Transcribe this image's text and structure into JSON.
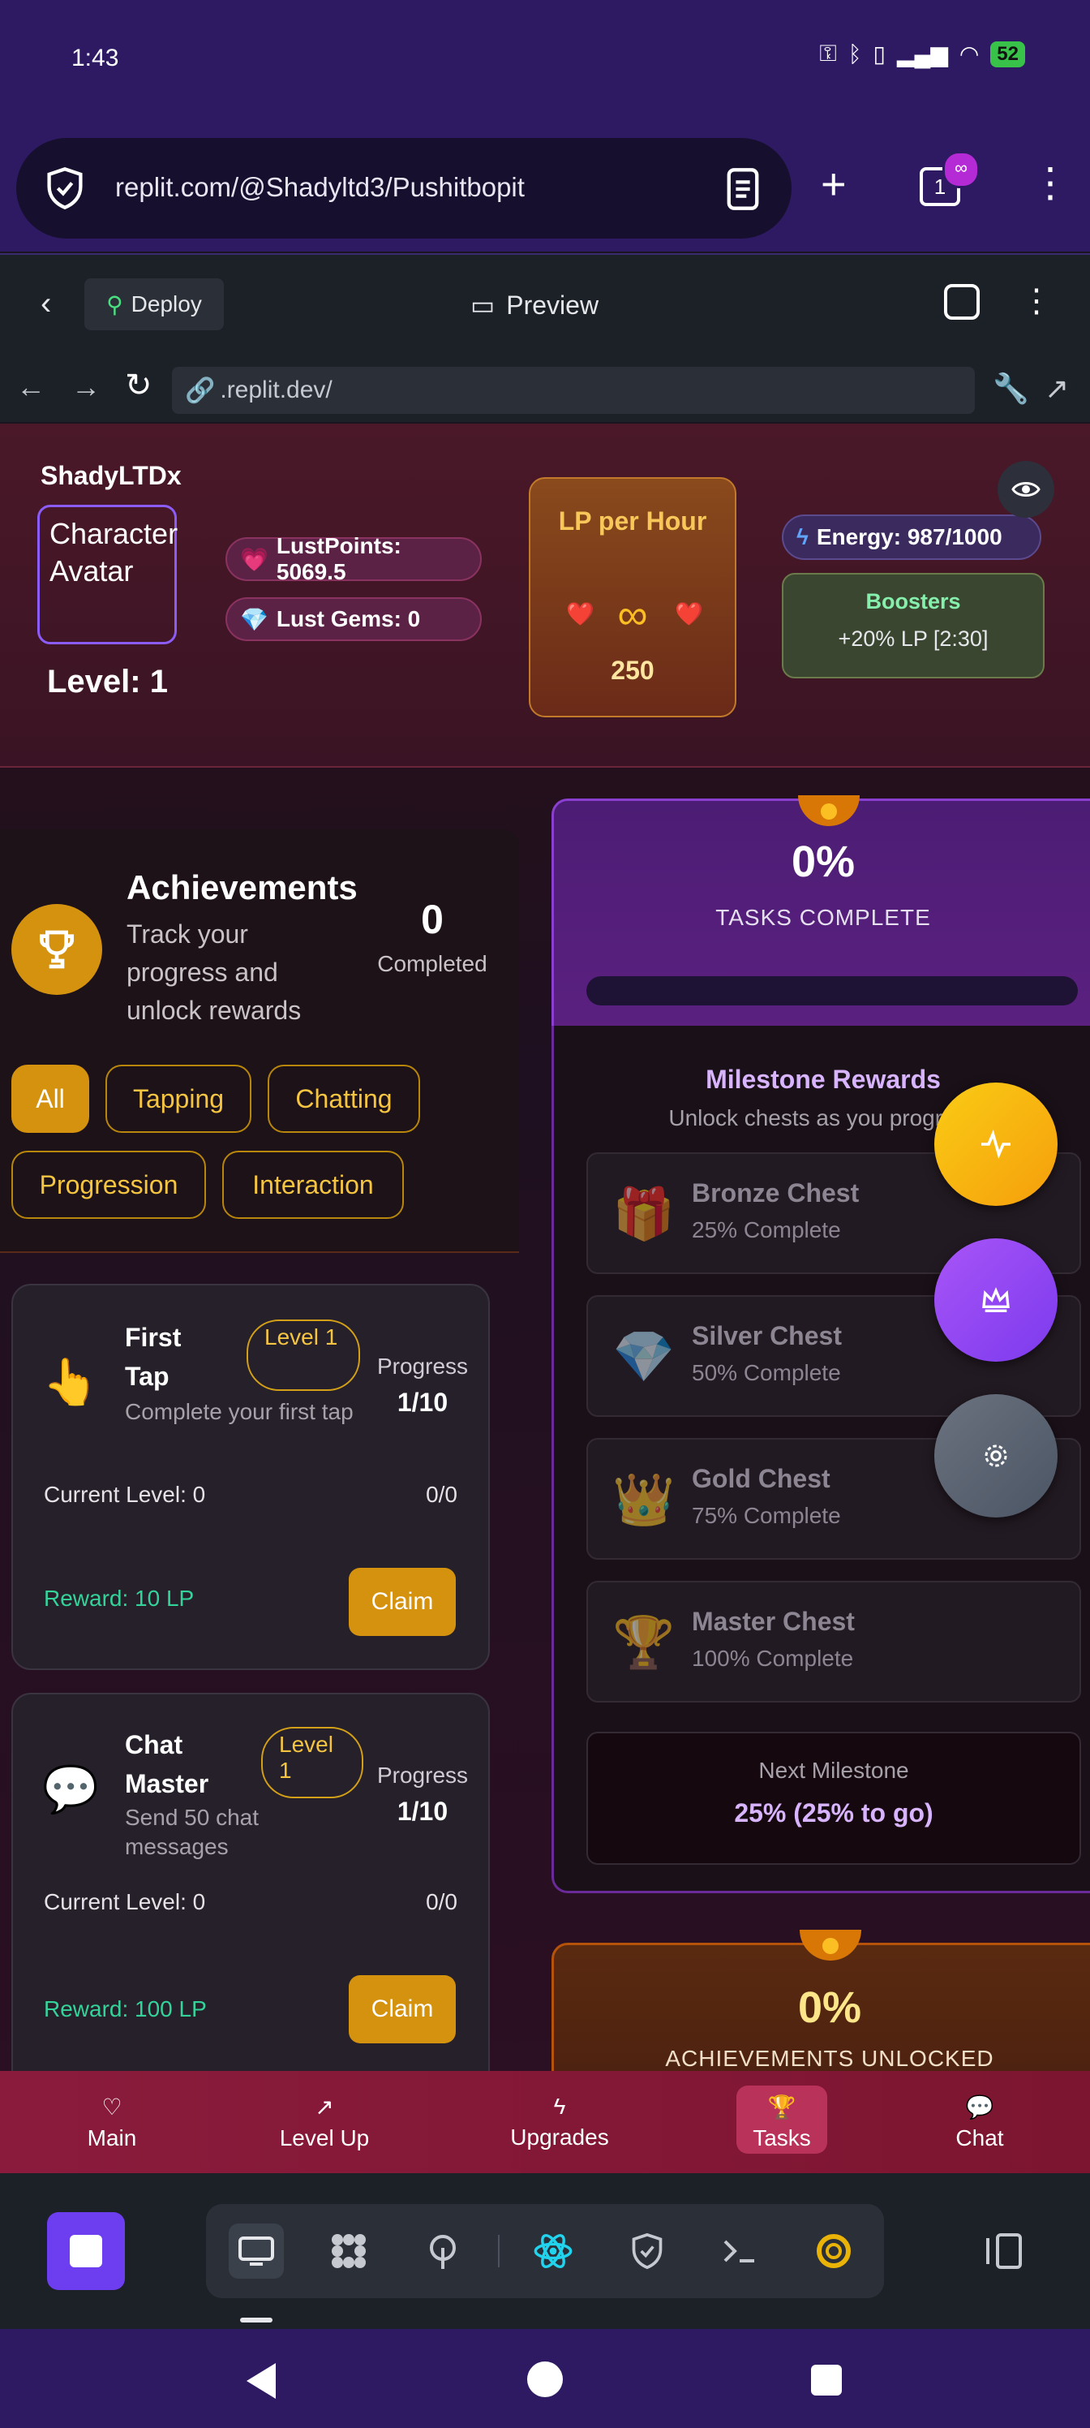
{
  "status_bar": {
    "time": "1:43",
    "battery": "52"
  },
  "browser": {
    "url": "replit.com/@Shadyltd3/Pushitbopit",
    "tab_count": "1",
    "new_tab": "+",
    "menu": "⋮"
  },
  "replit": {
    "deploy_label": "Deploy",
    "preview_label": "Preview",
    "address": ".replit.dev/"
  },
  "game": {
    "header": {
      "username": "ShadyLTDx",
      "avatar_text": "Character Avatar",
      "level": "Level: 1",
      "lust_points": "LustPoints: 5069.5",
      "lust_gems": "Lust Gems: 0",
      "lp_per_hour_title": "LP per Hour",
      "lp_per_hour_symbol": "∞",
      "lp_per_hour_value": "250",
      "energy": "Energy: 987/1000",
      "boosters_title": "Boosters",
      "boosters_value": "+20% LP [2:30]"
    },
    "achievements": {
      "title": "Achievements",
      "description": "Track your progress and unlock rewards",
      "completed_count": "0",
      "completed_label": "Completed",
      "filters": [
        "All",
        "Tapping",
        "Chatting",
        "Progression",
        "Interaction"
      ],
      "active_filter": "All",
      "cards": [
        {
          "icon": "👆",
          "title": "First Tap",
          "level": "Level 1",
          "description": "Complete your first tap",
          "progress_label": "Progress",
          "progress": "1/10",
          "current_level": "Current Level: 0",
          "ratio": "0/0",
          "reward": "Reward: 10 LP",
          "claim": "Claim"
        },
        {
          "icon": "💬",
          "title": "Chat Master",
          "level": "Level 1",
          "description": "Send 50 chat messages",
          "progress_label": "Progress",
          "progress": "1/10",
          "current_level": "Current Level: 0",
          "ratio": "0/0",
          "reward": "Reward: 100 LP",
          "claim": "Claim"
        }
      ]
    },
    "tasks": {
      "percent": "0%",
      "label": "TASKS COMPLETE",
      "progress_fraction": 0,
      "milestone_title": "Milestone Rewards",
      "milestone_subtitle": "Unlock chests as you progress",
      "chests": [
        {
          "icon": "🎁",
          "name": "Bronze Chest",
          "requirement": "25% Complete"
        },
        {
          "icon": "💎",
          "name": "Silver Chest",
          "requirement": "50% Complete"
        },
        {
          "icon": "👑",
          "name": "Gold Chest",
          "requirement": "75% Complete"
        },
        {
          "icon": "🏆",
          "name": "Master Chest",
          "requirement": "100% Complete"
        }
      ],
      "next_milestone_label": "Next Milestone",
      "next_milestone_value": "25% (25% to go)"
    },
    "achievements_unlocked": {
      "percent": "0%",
      "label": "ACHIEVEMENTS UNLOCKED"
    },
    "bottom_nav": [
      {
        "icon": "heart-icon",
        "label": "Main"
      },
      {
        "icon": "trending-up-icon",
        "label": "Level Up"
      },
      {
        "icon": "bolt-icon",
        "label": "Upgrades"
      },
      {
        "icon": "trophy-icon",
        "label": "Tasks"
      },
      {
        "icon": "chat-icon",
        "label": "Chat"
      }
    ],
    "active_nav": "Tasks"
  }
}
